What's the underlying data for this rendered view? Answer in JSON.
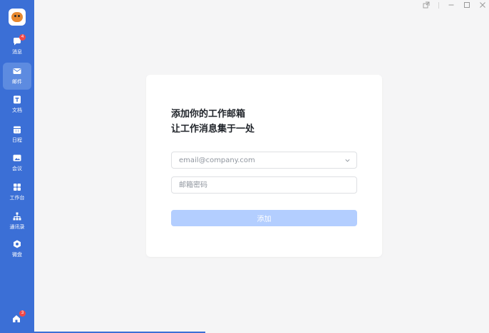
{
  "sidebar": {
    "logo_icon": "tiger-logo-icon",
    "items": [
      {
        "label": "消息",
        "icon": "chat-bubble-icon",
        "badge": "4"
      },
      {
        "label": "邮件",
        "icon": "mail-icon",
        "active": true
      },
      {
        "label": "文档",
        "icon": "document-icon"
      },
      {
        "label": "日程",
        "icon": "calendar-icon"
      },
      {
        "label": "会议",
        "icon": "video-meeting-icon"
      },
      {
        "label": "工作台",
        "icon": "grid-apps-icon"
      },
      {
        "label": "通讯录",
        "icon": "org-chart-icon"
      },
      {
        "label": "微盘",
        "icon": "cloud-drive-icon"
      }
    ],
    "bottom_item": {
      "icon": "home-icon",
      "badge": "3"
    }
  },
  "window_controls": {
    "icons": [
      "pop-out-icon",
      "minimize-icon",
      "maximize-icon",
      "close-icon"
    ]
  },
  "card": {
    "title_line1": "添加你的工作邮箱",
    "title_line2": "让工作消息集于一处",
    "email_field": {
      "placeholder": "email@company.com",
      "value": ""
    },
    "password_field": {
      "placeholder": "邮箱密码",
      "value": ""
    },
    "submit_label": "添加"
  },
  "colors": {
    "sidebar": "#3b6fd6",
    "sidebar_active": "#5d8be0",
    "badge": "#f04848",
    "button_disabled": "#b3ceff",
    "background": "#f5f5f6"
  }
}
